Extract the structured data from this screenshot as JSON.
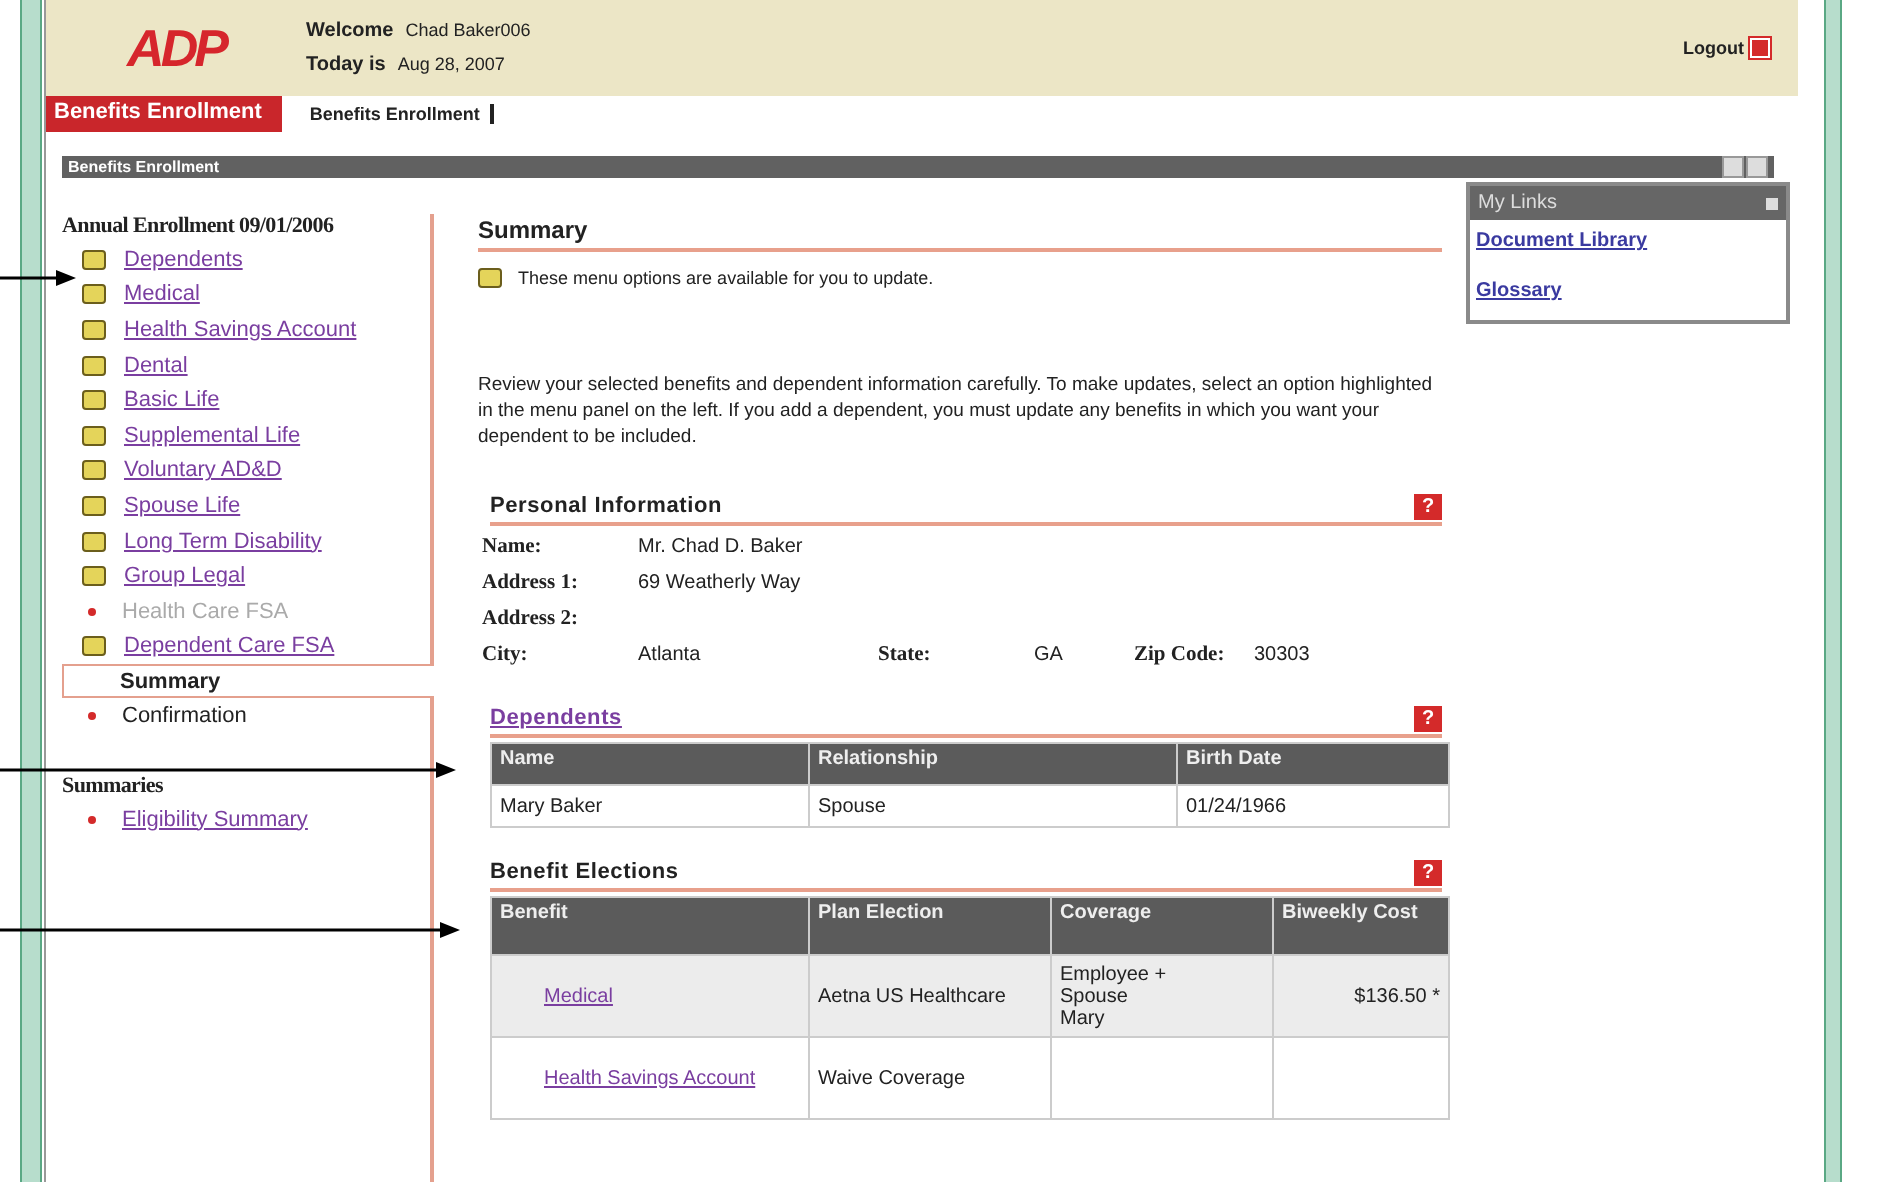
{
  "header": {
    "logo": "ADP",
    "welcome_label": "Welcome",
    "user": "Chad Baker006",
    "today_label": "Today is",
    "date": "Aug 28, 2007",
    "logout": "Logout"
  },
  "nav": {
    "active_tab": "Benefits Enrollment",
    "breadcrumb": "Benefits Enrollment"
  },
  "panel": {
    "title": "Benefits Enrollment"
  },
  "sidebar": {
    "sections": [
      {
        "title": "Annual Enrollment 09/01/2006",
        "items": [
          {
            "label": "Dependents",
            "kind": "available",
            "selected": false
          },
          {
            "label": "Medical",
            "kind": "available",
            "selected": false
          },
          {
            "label": "Health Savings Account",
            "kind": "available",
            "selected": false
          },
          {
            "label": "Dental",
            "kind": "available",
            "selected": false
          },
          {
            "label": "Basic Life",
            "kind": "available",
            "selected": false
          },
          {
            "label": "Supplemental Life",
            "kind": "available",
            "selected": false
          },
          {
            "label": "Voluntary AD&D",
            "kind": "available",
            "selected": false
          },
          {
            "label": "Spouse Life",
            "kind": "available",
            "selected": false
          },
          {
            "label": "Long Term Disability",
            "kind": "available",
            "selected": false
          },
          {
            "label": "Group Legal",
            "kind": "available",
            "selected": false
          },
          {
            "label": "Health Care FSA",
            "kind": "unavailable",
            "selected": false
          },
          {
            "label": "Dependent Care FSA",
            "kind": "available",
            "selected": false
          },
          {
            "label": "Summary",
            "kind": "current",
            "selected": true
          },
          {
            "label": "Confirmation",
            "kind": "pending",
            "selected": false
          }
        ]
      },
      {
        "title": "Summaries",
        "items": [
          {
            "label": "Eligibility Summary",
            "kind": "link",
            "selected": false
          }
        ]
      }
    ]
  },
  "main": {
    "title": "Summary",
    "legend": "These menu options are available for you to update.",
    "intro": "Review your selected benefits and dependent information carefully.  To make updates, select an option highlighted in the menu panel on the left. If you add a dependent, you must update any benefits in which you want your dependent to be included.",
    "personal": {
      "title": "Personal Information",
      "help": "?",
      "rows": [
        [
          {
            "label": "Name:",
            "value": "Mr. Chad D. Baker"
          }
        ],
        [
          {
            "label": "Address 1:",
            "value": "69 Weatherly Way"
          }
        ],
        [
          {
            "label": "Address 2:"
          }
        ],
        [
          {
            "label": "City:",
            "value": "Atlanta"
          },
          {
            "label": "State:",
            "value": "GA"
          },
          {
            "label": "Zip Code:",
            "value": "30303"
          }
        ]
      ]
    },
    "dependents": {
      "title": "Dependents",
      "help": "?",
      "columns": [
        "Name",
        "Relationship",
        "Birth Date"
      ],
      "rows": [
        [
          "Mary Baker",
          "Spouse",
          "01/24/1966"
        ]
      ]
    },
    "elections": {
      "title": "Benefit Elections",
      "help": "?",
      "columns": [
        "Benefit",
        "Plan Election",
        "Coverage",
        "Biweekly Cost"
      ],
      "rows": [
        {
          "benefit": "Medical",
          "plan": "Aetna US Healthcare",
          "coverage": [
            "Employee +",
            "Spouse",
            "Mary"
          ],
          "cost": "$136.50 *"
        },
        {
          "benefit": "Health Savings Account",
          "plan": "Waive Coverage"
        }
      ]
    }
  },
  "my_links": {
    "title": "My Links",
    "links": [
      "Document Library",
      "Glossary"
    ]
  }
}
